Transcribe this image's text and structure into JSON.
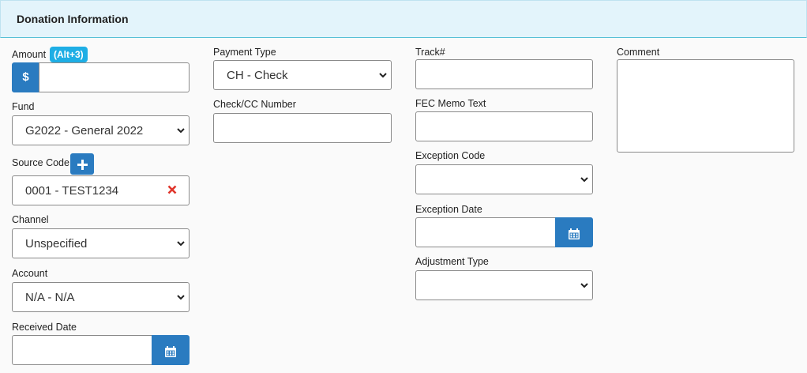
{
  "panel": {
    "title": "Donation Information"
  },
  "col1": {
    "amount_label": "Amount",
    "amount_shortcut": "(Alt+3)",
    "amount_prefix": "$",
    "amount_value": "",
    "fund_label": "Fund",
    "fund_value": "G2022 - General 2022",
    "source_label": "Source Code",
    "source_value": "0001 - TEST1234",
    "channel_label": "Channel",
    "channel_value": "Unspecified",
    "account_label": "Account",
    "account_value": "N/A - N/A",
    "received_label": "Received Date",
    "received_value": ""
  },
  "col2": {
    "payment_label": "Payment Type",
    "payment_value": "CH - Check",
    "check_label": "Check/CC Number",
    "check_value": ""
  },
  "col3": {
    "track_label": "Track#",
    "track_value": "",
    "fec_label": "FEC Memo Text",
    "fec_value": "",
    "exception_code_label": "Exception Code",
    "exception_code_value": "",
    "exception_date_label": "Exception Date",
    "exception_date_value": "",
    "adjustment_label": "Adjustment Type",
    "adjustment_value": ""
  },
  "col4": {
    "comment_label": "Comment",
    "comment_value": ""
  },
  "colors": {
    "accent": "#2a7bc0",
    "badge": "#1eaee5",
    "header_bg": "#e3f4fb",
    "clear": "#e0352b"
  }
}
